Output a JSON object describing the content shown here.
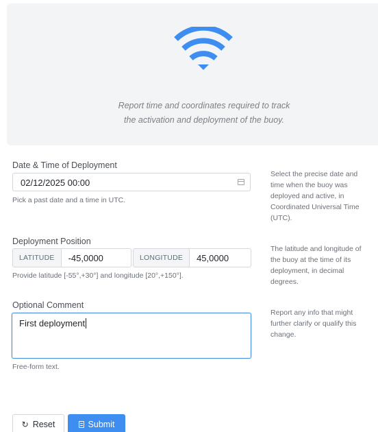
{
  "hero": {
    "icon": "wifi-icon",
    "accent_color": "#3d8ef0",
    "description_line1": "Report time and coordinates required to track",
    "description_line2": "the activation and deployment of the buoy."
  },
  "form": {
    "datetime": {
      "label": "Date & Time of Deployment",
      "value": "02/12/2025 00:00",
      "icon": "calendar-icon",
      "help": "Pick a past date and a time in UTC.",
      "side_help": "Select the precise date and time when the buoy was deployed and active, in Coordinated Universal Time (UTC)."
    },
    "position": {
      "label": "Deployment Position",
      "latitude_addon": "LATITUDE",
      "latitude_value": "-45,0000",
      "longitude_addon": "LONGITUDE",
      "longitude_value": "45,0000",
      "help": "Provide latitude [-55°,+30°] and longitude [20°,+150°].",
      "side_help": "The latitude and longitude of the buoy at the time of its deployment, in decimal degrees."
    },
    "comment": {
      "label": "Optional Comment",
      "value": "First deployment",
      "help": "Free-form text.",
      "side_help": "Report any info that might further clarify or qualify this change."
    }
  },
  "actions": {
    "reset_label": "Reset",
    "reset_icon": "refresh-icon",
    "submit_label": "Submit",
    "submit_icon": "document-icon",
    "submit_color": "#3d8ef0"
  }
}
